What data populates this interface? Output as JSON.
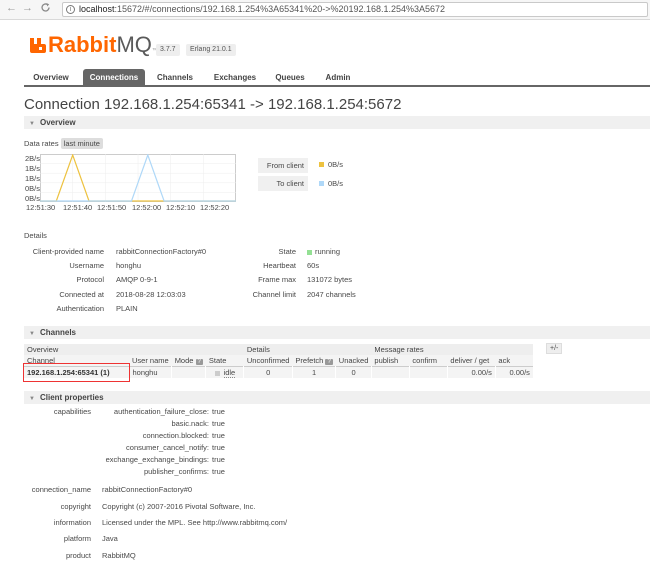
{
  "browser": {
    "back": "←",
    "forward": "→",
    "reload": "C",
    "url_host": "localhost",
    "url_rest": ":15672/#/connections/192.168.1.254%3A65341%20->%20192.168.1.254%3A5672"
  },
  "header": {
    "logo_rabbit": "Rabbit",
    "logo_mq": "MQ",
    "logo_tm": "™",
    "version": "3.7.7",
    "erlang": "Erlang 21.0.1"
  },
  "tabs": [
    {
      "label": "Overview",
      "active": false
    },
    {
      "label": "Connections",
      "active": true
    },
    {
      "label": "Channels",
      "active": false
    },
    {
      "label": "Exchanges",
      "active": false
    },
    {
      "label": "Queues",
      "active": false
    },
    {
      "label": "Admin",
      "active": false
    }
  ],
  "page_title": "Connection 192.168.1.254:65341 -> 192.168.1.254:5672",
  "overview": {
    "section_label": "Overview",
    "data_rates_label": "Data rates",
    "range_label": "last minute",
    "from_client_label": "From client",
    "from_client_value": "0B/s",
    "to_client_label": "To client",
    "to_client_value": "0B/s",
    "from_color": "#edc240",
    "to_color": "#afd8f8"
  },
  "chart_data": {
    "type": "line",
    "y_ticks": [
      "2B/s",
      "1B/s",
      "1B/s",
      "0B/s",
      "0B/s"
    ],
    "x_ticks": [
      "12:51:30",
      "12:51:40",
      "12:51:50",
      "12:52:00",
      "12:52:10",
      "12:52:20"
    ],
    "ylim": [
      0,
      2
    ],
    "series": [
      {
        "name": "From client",
        "color": "#edc240",
        "x": [
          0,
          5,
          10,
          15,
          60
        ],
        "y": [
          0,
          0,
          2,
          0,
          0
        ]
      },
      {
        "name": "To client",
        "color": "#afd8f8",
        "x": [
          0,
          28,
          33,
          38,
          60
        ],
        "y": [
          0,
          0,
          2,
          0,
          0
        ]
      }
    ],
    "grid": true
  },
  "details": {
    "label": "Details",
    "left": [
      {
        "key": "Client-provided name",
        "value": "rabbitConnectionFactory#0"
      },
      {
        "key": "Username",
        "value": "honghu"
      },
      {
        "key": "Protocol",
        "value": "AMQP 0-9-1"
      },
      {
        "key": "Connected at",
        "value": "2018-08-28 12:03:03"
      },
      {
        "key": "Authentication",
        "value": "PLAIN"
      }
    ],
    "right": [
      {
        "key": "State",
        "value": "running"
      },
      {
        "key": "Heartbeat",
        "value": "60s"
      },
      {
        "key": "Frame max",
        "value": "131072 bytes"
      },
      {
        "key": "Channel limit",
        "value": "2047 channels"
      }
    ],
    "running_color": "#94e094"
  },
  "channels": {
    "section_label": "Channels",
    "group_overview": "Overview",
    "group_details": "Details",
    "group_rates": "Message rates",
    "plus_minus": "+/-",
    "headers": {
      "channel": "Channel",
      "user": "User name",
      "mode": "Mode",
      "state": "State",
      "unconfirmed": "Unconfirmed",
      "prefetch": "Prefetch",
      "unacked": "Unacked",
      "publish": "publish",
      "confirm": "confirm",
      "deliver": "deliver / get",
      "ack": "ack"
    },
    "q": "?",
    "row": {
      "channel": "192.168.1.254:65341 (1)",
      "user": "honghu",
      "mode": "",
      "state": "idle",
      "unconfirmed": "0",
      "prefetch": "1",
      "unacked": "0",
      "publish": "",
      "confirm": "",
      "deliver": "0.00/s",
      "ack": "0.00/s"
    }
  },
  "client_properties": {
    "section_label": "Client properties",
    "capabilities_key": "capabilities",
    "capabilities": [
      {
        "key": "authentication_failure_close:",
        "value": "true"
      },
      {
        "key": "basic.nack:",
        "value": "true"
      },
      {
        "key": "connection.blocked:",
        "value": "true"
      },
      {
        "key": "consumer_cancel_notify:",
        "value": "true"
      },
      {
        "key": "exchange_exchange_bindings:",
        "value": "true"
      },
      {
        "key": "publisher_confirms:",
        "value": "true"
      }
    ],
    "props": [
      {
        "key": "connection_name",
        "value": "rabbitConnectionFactory#0"
      },
      {
        "key": "copyright",
        "value": "Copyright (c) 2007-2016 Pivotal Software, Inc."
      },
      {
        "key": "information",
        "value": "Licensed under the MPL. See http://www.rabbitmq.com/"
      },
      {
        "key": "platform",
        "value": "Java"
      },
      {
        "key": "product",
        "value": "RabbitMQ"
      }
    ]
  }
}
